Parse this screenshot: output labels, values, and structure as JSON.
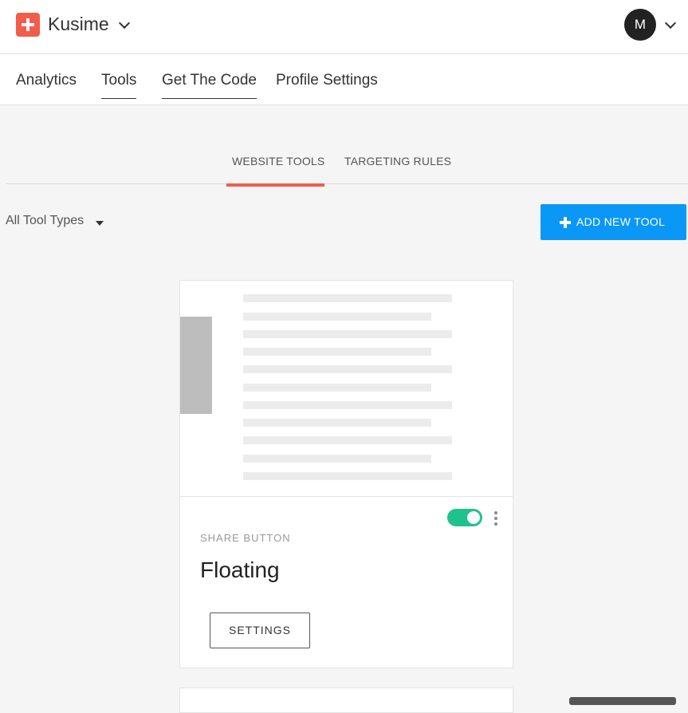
{
  "header": {
    "site_name": "Kusime",
    "avatar_initial": "M",
    "brand_color": "#f25c4b"
  },
  "main_nav": {
    "items": [
      {
        "label": "Analytics"
      },
      {
        "label": "Tools"
      },
      {
        "label": "Get The Code"
      },
      {
        "label": "Profile Settings"
      }
    ]
  },
  "sub_tabs": {
    "items": [
      {
        "label": "WEBSITE TOOLS",
        "active": true
      },
      {
        "label": "TARGETING RULES",
        "active": false
      }
    ],
    "active_color": "#f25c4b"
  },
  "toolbar": {
    "filter_label": "All Tool Types",
    "add_button_label": "ADD NEW TOOL",
    "add_button_color": "#0a97f5"
  },
  "tool_cards": [
    {
      "type_label": "SHARE BUTTON",
      "name": "Floating",
      "enabled": true,
      "settings_label": "SETTINGS",
      "toggle_color": "#1fc28d"
    }
  ]
}
